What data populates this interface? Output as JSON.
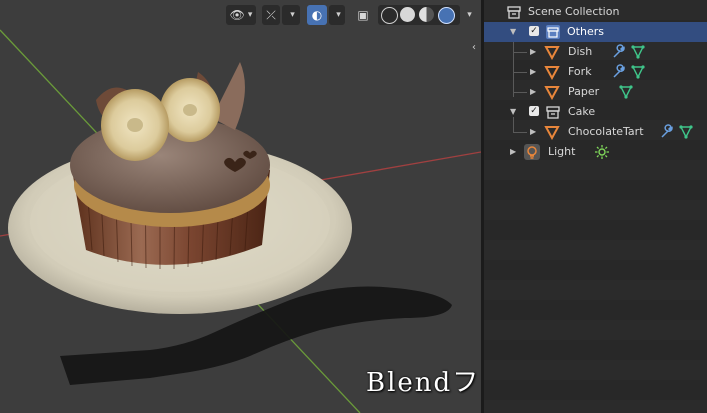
{
  "viewport": {
    "caption": "Blendファイルあります",
    "colors": {
      "background": "#3d3d3d",
      "x_axis": "#a04040",
      "y_axis": "#6a9a3a"
    }
  },
  "outliner": {
    "rows": [
      {
        "label": "Scene Collection",
        "icon": "scene-collection-icon",
        "expanded": true
      },
      {
        "label": "Others",
        "icon": "collection-icon",
        "checked": true,
        "selected": true,
        "expanded": true
      },
      {
        "label": "Dish",
        "icon": "mesh-object-icon",
        "modifiers": [
          "wrench-icon",
          "mesh-data-icon"
        ]
      },
      {
        "label": "Fork",
        "icon": "mesh-object-icon",
        "modifiers": [
          "wrench-icon",
          "mesh-data-icon"
        ]
      },
      {
        "label": "Paper",
        "icon": "mesh-object-icon",
        "modifiers": [
          "mesh-data-icon"
        ]
      },
      {
        "label": "Cake",
        "icon": "collection-icon",
        "checked": true,
        "expanded": true
      },
      {
        "label": "ChocolateTart",
        "icon": "mesh-object-icon",
        "modifiers": [
          "wrench-icon",
          "mesh-data-icon"
        ]
      },
      {
        "label": "Light",
        "icon": "light-object-icon",
        "modifiers": [
          "light-data-icon"
        ]
      }
    ],
    "colors": {
      "selected": "#334d80",
      "object": "#e8863b",
      "modifier": "#6aa0e0",
      "data": "#3fc58a",
      "light_data": "#7fd65a"
    }
  }
}
